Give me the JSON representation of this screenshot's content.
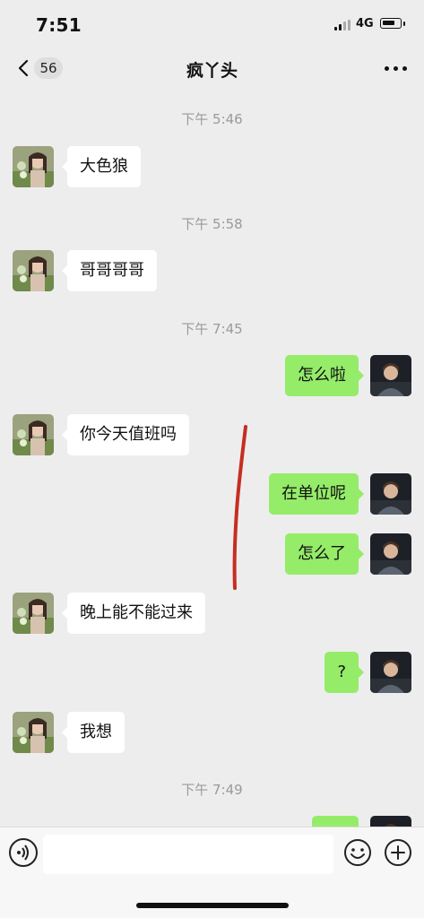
{
  "status_bar": {
    "time": "7:51",
    "network": "4G"
  },
  "header": {
    "unread_count": "56",
    "title": "疯丫头",
    "more_icon": "more-dots-icon",
    "back_icon": "chevron-left-icon"
  },
  "messages": [
    {
      "type": "timestamp",
      "text": "下午 5:46"
    },
    {
      "type": "incoming",
      "text": "大色狼"
    },
    {
      "type": "timestamp",
      "text": "下午 5:58"
    },
    {
      "type": "incoming",
      "text": "哥哥哥哥"
    },
    {
      "type": "timestamp",
      "text": "下午 7:45"
    },
    {
      "type": "outgoing",
      "text": "怎么啦"
    },
    {
      "type": "incoming",
      "text": "你今天值班吗"
    },
    {
      "type": "outgoing",
      "text": "在单位呢"
    },
    {
      "type": "outgoing",
      "text": "怎么了"
    },
    {
      "type": "incoming",
      "text": "晚上能不能过来"
    },
    {
      "type": "outgoing",
      "text": "?"
    },
    {
      "type": "incoming",
      "text": "我想"
    },
    {
      "type": "timestamp",
      "text": "下午 7:49"
    },
    {
      "type": "outgoing",
      "text": ""
    }
  ],
  "input_bar": {
    "placeholder": "",
    "voice_icon": "voice-icon",
    "emoji_icon": "emoji-icon",
    "plus_icon": "plus-circle-icon"
  },
  "colors": {
    "background": "#ededed",
    "outgoing_bubble": "#95ec69",
    "incoming_bubble": "#ffffff",
    "timestamp_text": "#9a9a9a",
    "annotation_stroke": "#c62d22"
  }
}
